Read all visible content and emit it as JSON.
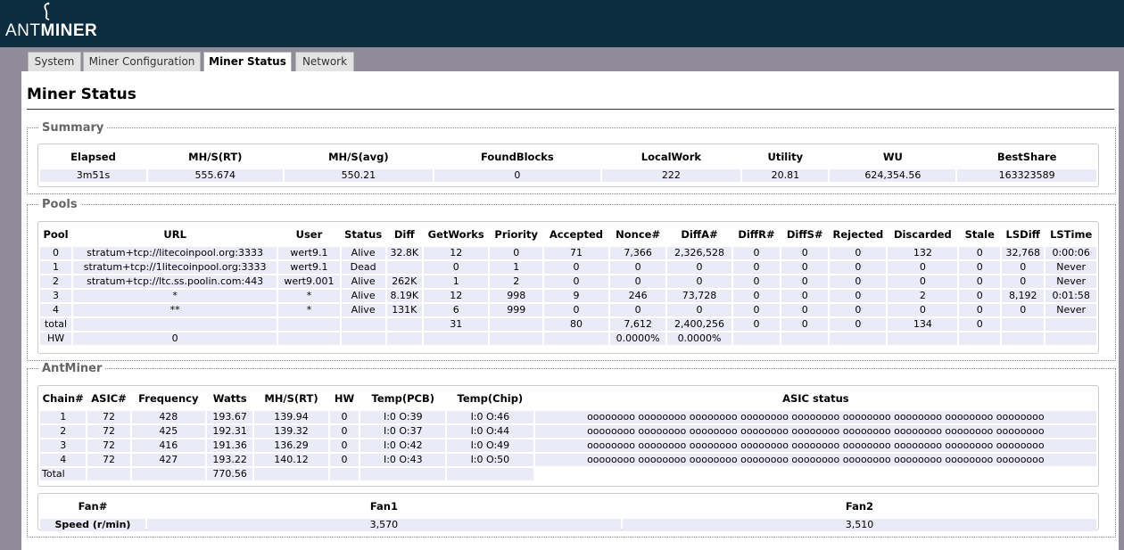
{
  "brand": {
    "prefix": "ANT",
    "suffix": "MINER"
  },
  "tabs": [
    {
      "label": "System"
    },
    {
      "label": "Miner Configuration"
    },
    {
      "label": "Miner Status"
    },
    {
      "label": "Network"
    }
  ],
  "page_title": "Miner Status",
  "summary": {
    "legend": "Summary",
    "headers": [
      "Elapsed",
      "MH/S(RT)",
      "MH/S(avg)",
      "FoundBlocks",
      "LocalWork",
      "Utility",
      "WU",
      "BestShare"
    ],
    "values": [
      "3m51s",
      "555.674",
      "550.21",
      "0",
      "222",
      "20.81",
      "624,354.56",
      "163323589"
    ]
  },
  "pools": {
    "legend": "Pools",
    "headers": [
      "Pool",
      "URL",
      "User",
      "Status",
      "Diff",
      "GetWorks",
      "Priority",
      "Accepted",
      "Nonce#",
      "DiffA#",
      "DiffR#",
      "DiffS#",
      "Rejected",
      "Discarded",
      "Stale",
      "LSDiff",
      "LSTime"
    ],
    "rows": [
      [
        "0",
        "stratum+tcp://litecoinpool.org:3333",
        "wert9.1",
        "Alive",
        "32.8K",
        "12",
        "0",
        "71",
        "7,366",
        "2,326,528",
        "0",
        "0",
        "0",
        "132",
        "0",
        "32,768",
        "0:00:06"
      ],
      [
        "1",
        "stratum+tcp://1litecoinpool.org:3333",
        "wert9.1",
        "Dead",
        "",
        "0",
        "1",
        "0",
        "0",
        "0",
        "0",
        "0",
        "0",
        "0",
        "0",
        "0",
        "Never"
      ],
      [
        "2",
        "stratum+tcp://ltc.ss.poolin.com:443",
        "wert9.001",
        "Alive",
        "262K",
        "1",
        "2",
        "0",
        "0",
        "0",
        "0",
        "0",
        "0",
        "0",
        "0",
        "0",
        "Never"
      ],
      [
        "3",
        "*",
        "*",
        "Alive",
        "8.19K",
        "12",
        "998",
        "9",
        "246",
        "73,728",
        "0",
        "0",
        "0",
        "2",
        "0",
        "8,192",
        "0:01:58"
      ],
      [
        "4",
        "**",
        "*",
        "Alive",
        "131K",
        "6",
        "999",
        "0",
        "0",
        "0",
        "0",
        "0",
        "0",
        "0",
        "0",
        "0",
        "Never"
      ],
      [
        "total",
        "",
        "",
        "",
        "",
        "31",
        "",
        "80",
        "7,612",
        "2,400,256",
        "0",
        "0",
        "0",
        "134",
        "0",
        "",
        ""
      ],
      [
        "HW",
        "0",
        "",
        "",
        "",
        "",
        "",
        "",
        "0.0000%",
        "0.0000%",
        "",
        "",
        "",
        "",
        "",
        "",
        ""
      ]
    ]
  },
  "antminer": {
    "legend": "AntMiner",
    "headers": [
      "Chain#",
      "ASIC#",
      "Frequency",
      "Watts",
      "MH/S(RT)",
      "HW",
      "Temp(PCB)",
      "Temp(Chip)",
      "ASIC status"
    ],
    "rows": [
      [
        "1",
        "72",
        "428",
        "193.67",
        "139.94",
        "0",
        "I:0 O:39",
        "I:0 O:46",
        "oooooooo oooooooo oooooooo oooooooo oooooooo oooooooo oooooooo oooooooo oooooooo"
      ],
      [
        "2",
        "72",
        "425",
        "192.31",
        "139.32",
        "0",
        "I:0 O:37",
        "I:0 O:44",
        "oooooooo oooooooo oooooooo oooooooo oooooooo oooooooo oooooooo oooooooo oooooooo"
      ],
      [
        "3",
        "72",
        "416",
        "191.36",
        "136.29",
        "0",
        "I:0 O:42",
        "I:0 O:49",
        "oooooooo oooooooo oooooooo oooooooo oooooooo oooooooo oooooooo oooooooo oooooooo"
      ],
      [
        "4",
        "72",
        "427",
        "193.22",
        "140.12",
        "0",
        "I:0 O:43",
        "I:0 O:50",
        "oooooooo oooooooo oooooooo oooooooo oooooooo oooooooo oooooooo oooooooo oooooooo"
      ]
    ],
    "total_row": [
      "Total",
      "",
      "",
      "770.56",
      "",
      "",
      "",
      ""
    ]
  },
  "fans": {
    "headers": [
      "Fan#",
      "Fan1",
      "Fan2"
    ],
    "row_label": "Speed (r/min)",
    "values": [
      "3,570",
      "3,510"
    ]
  }
}
